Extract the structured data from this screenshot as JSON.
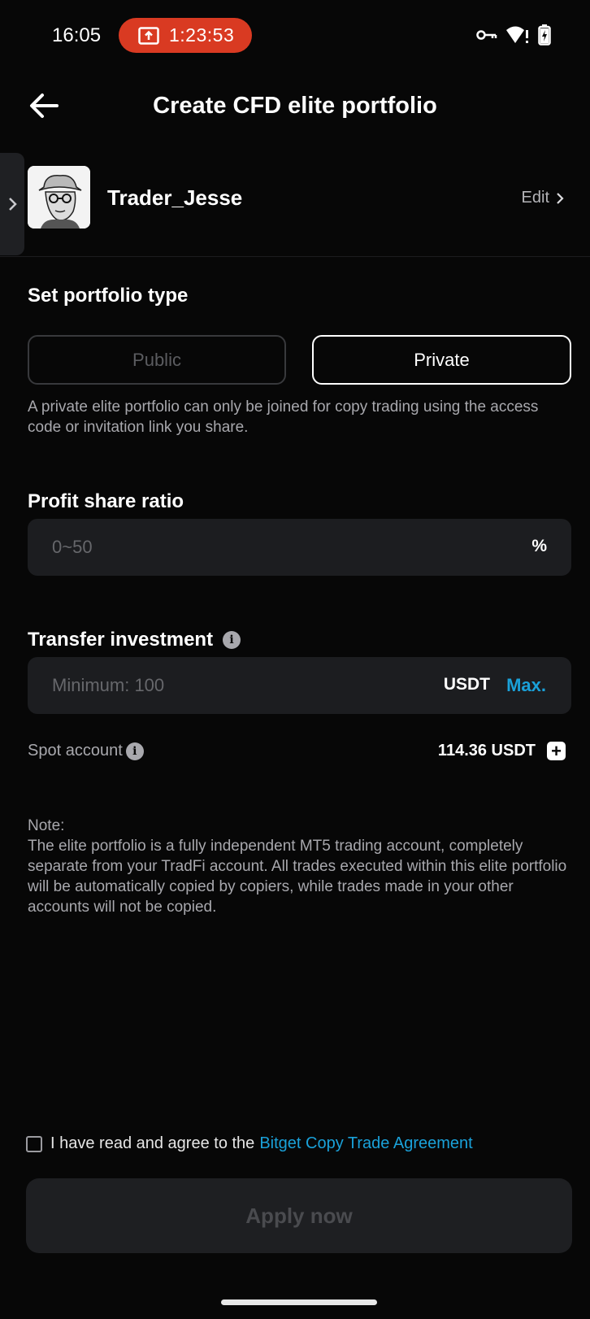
{
  "status_bar": {
    "time": "16:05",
    "recording_time": "1:23:53",
    "icons": [
      "vpn-key-icon",
      "wifi-alert-icon",
      "battery-charging-icon"
    ]
  },
  "header": {
    "title": "Create CFD elite portfolio",
    "back_icon": "arrow-left-icon"
  },
  "profile": {
    "username": "Trader_Jesse",
    "edit_label": "Edit"
  },
  "portfolio_type": {
    "title": "Set portfolio type",
    "options": [
      "Public",
      "Private"
    ],
    "selected": "Private",
    "description": "A private elite portfolio can only be joined for copy trading using the access code or invitation link you share."
  },
  "profit_share": {
    "title": "Profit share ratio",
    "placeholder": "0~50",
    "unit": "%"
  },
  "transfer": {
    "title": "Transfer investment",
    "placeholder": "Minimum: 100",
    "currency": "USDT",
    "max_label": "Max."
  },
  "spot_account": {
    "label": "Spot account",
    "balance": "114.36 USDT"
  },
  "note": {
    "text": "Note:\nThe elite portfolio is a fully independent MT5 trading account, completely separate from your TradFi account. All trades executed within this elite portfolio will be automatically copied by copiers, while trades made in your other accounts will not be copied."
  },
  "agreement": {
    "prefix": "I have read and agree to the",
    "link": "Bitget Copy Trade Agreement",
    "checked": false
  },
  "apply_button": {
    "label": "Apply now"
  },
  "colors": {
    "background": "#070707",
    "accent": "#1aa1d9",
    "recording": "#d93a22",
    "field_bg": "#1c1d20"
  }
}
